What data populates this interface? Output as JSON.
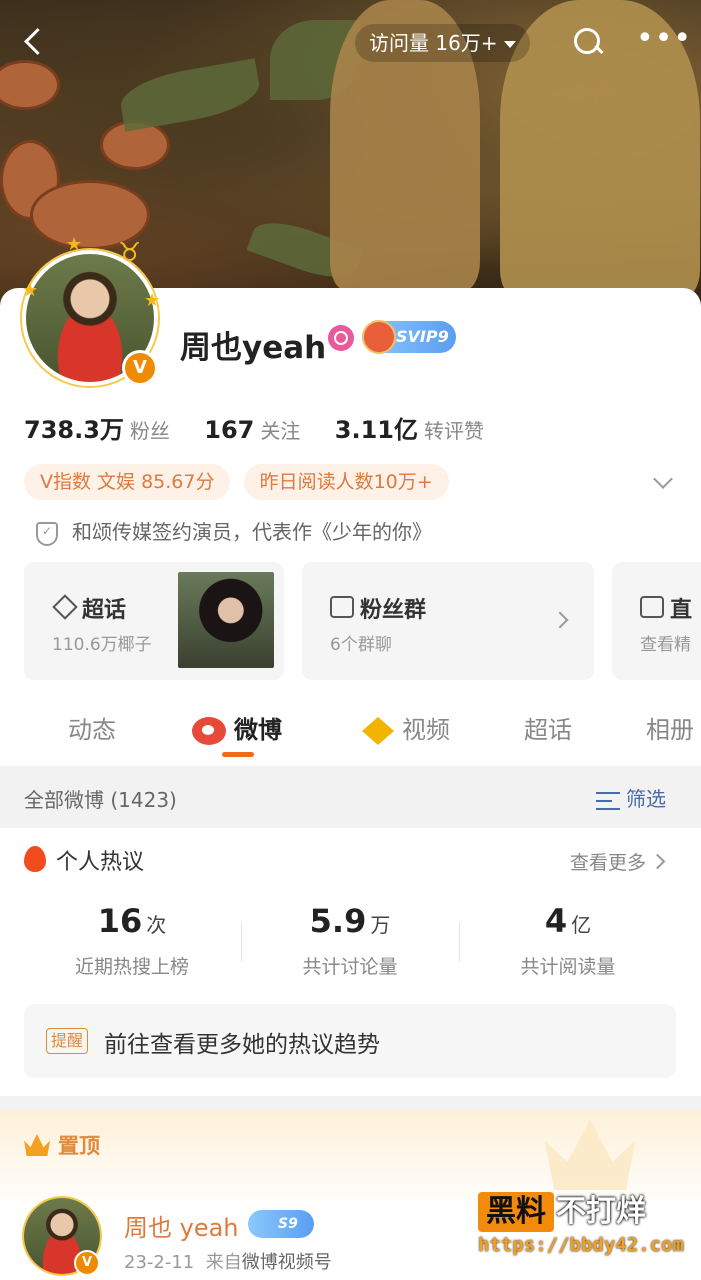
{
  "header": {
    "visit_label": "访问量 16万+"
  },
  "profile": {
    "name": "周也yeah",
    "vip_label": "SVIP9",
    "stats": [
      {
        "num": "738.3万",
        "label": "粉丝"
      },
      {
        "num": "167",
        "label": "关注"
      },
      {
        "num": "3.11亿",
        "label": "转评赞"
      }
    ],
    "tags": [
      "V指数 文娱 85.67分",
      "昨日阅读人数10万+"
    ],
    "verify_text": "和颂传媒签约演员，代表作《少年的你》"
  },
  "cards": [
    {
      "title": "超话",
      "sub": "110.6万椰子",
      "icon": "diamond-icon"
    },
    {
      "title": "粉丝群",
      "sub": "6个群聊",
      "icon": "tv-icon"
    },
    {
      "title": "直",
      "sub": "查看精",
      "icon": "tv-icon"
    }
  ],
  "tabs": [
    "动态",
    "微博",
    "视频",
    "超话",
    "相册"
  ],
  "active_tab": "微博",
  "section": {
    "all_label": "全部微博 (1423)",
    "filter_label": "筛选"
  },
  "hot": {
    "title": "个人热议",
    "see_more": "查看更多",
    "metrics": [
      {
        "value": "16",
        "unit": "次",
        "label": "近期热搜上榜"
      },
      {
        "value": "5.9",
        "unit": "万",
        "label": "共计讨论量"
      },
      {
        "value": "4",
        "unit": "亿",
        "label": "共计阅读量"
      }
    ],
    "reminder_chip": "提醒",
    "reminder_text": "前往查看更多她的热议趋势"
  },
  "pinned": {
    "label": "置顶",
    "post_name": "周也 yeah",
    "vip_label": "S9",
    "date": "23-2-11",
    "from_prefix": "来自",
    "source": "微博视频号"
  },
  "watermark": {
    "box": "黑料",
    "rest": "不打烊",
    "url": "https://bbdy42.com"
  },
  "colors": {
    "accent": "#f26a16",
    "tag_text": "#e07a3c",
    "link_blue": "#4a6aa8"
  }
}
